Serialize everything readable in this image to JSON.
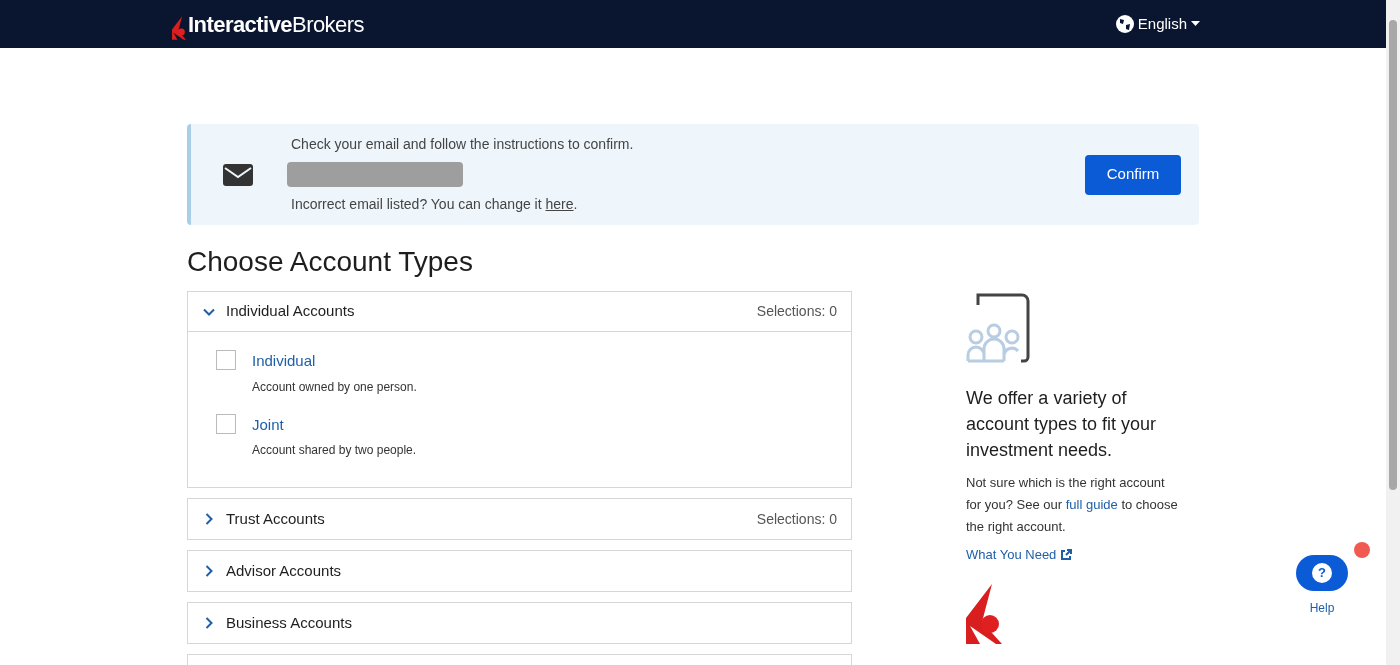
{
  "header": {
    "logo": "**Interactive**Brokers",
    "language": "English"
  },
  "notice": {
    "message": "Check your email and follow the instructions to confirm.",
    "change_text": "Incorrect email listed? You can change it ",
    "change_link": "here",
    "change_end": ".",
    "button": "Confirm"
  },
  "title": "Choose Account Types",
  "sections": [
    {
      "label": "Individual Accounts",
      "expanded": true,
      "selections": "Selections: 0",
      "options": [
        {
          "name": "Individual",
          "description": "Account owned by one person.",
          "checked": false
        },
        {
          "name": "Joint",
          "description": "Account shared by two people.",
          "checked": false
        }
      ]
    },
    {
      "label": "Trust Accounts",
      "expanded": false,
      "selections": "Selections: 0"
    },
    {
      "label": "Advisor Accounts",
      "expanded": false
    },
    {
      "label": "Business Accounts",
      "expanded": false
    }
  ],
  "side": {
    "heading": "We offer a variety of account types to fit your investment needs.",
    "text_before": "Not sure which is the right account for you? See our ",
    "link": "full guide",
    "text_after": " to choose the right account.",
    "what_you_need": "What You Need"
  },
  "help": {
    "glyph": "?",
    "label": "Help"
  }
}
